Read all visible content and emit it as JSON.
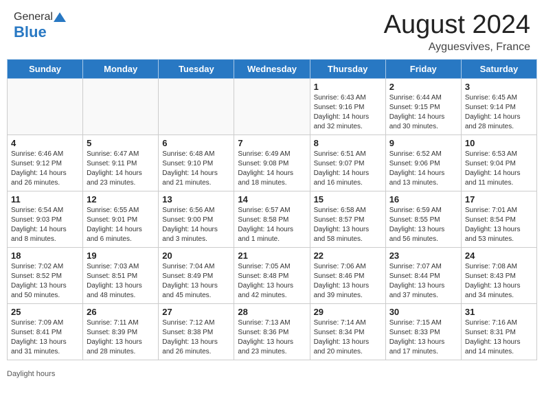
{
  "header": {
    "logo_general": "General",
    "logo_blue": "Blue",
    "month_title": "August 2024",
    "location": "Ayguesvives, France"
  },
  "footer": {
    "daylight_label": "Daylight hours"
  },
  "weekdays": [
    "Sunday",
    "Monday",
    "Tuesday",
    "Wednesday",
    "Thursday",
    "Friday",
    "Saturday"
  ],
  "weeks": [
    [
      {
        "day": "",
        "info": ""
      },
      {
        "day": "",
        "info": ""
      },
      {
        "day": "",
        "info": ""
      },
      {
        "day": "",
        "info": ""
      },
      {
        "day": "1",
        "info": "Sunrise: 6:43 AM\nSunset: 9:16 PM\nDaylight: 14 hours and 32 minutes."
      },
      {
        "day": "2",
        "info": "Sunrise: 6:44 AM\nSunset: 9:15 PM\nDaylight: 14 hours and 30 minutes."
      },
      {
        "day": "3",
        "info": "Sunrise: 6:45 AM\nSunset: 9:14 PM\nDaylight: 14 hours and 28 minutes."
      }
    ],
    [
      {
        "day": "4",
        "info": "Sunrise: 6:46 AM\nSunset: 9:12 PM\nDaylight: 14 hours and 26 minutes."
      },
      {
        "day": "5",
        "info": "Sunrise: 6:47 AM\nSunset: 9:11 PM\nDaylight: 14 hours and 23 minutes."
      },
      {
        "day": "6",
        "info": "Sunrise: 6:48 AM\nSunset: 9:10 PM\nDaylight: 14 hours and 21 minutes."
      },
      {
        "day": "7",
        "info": "Sunrise: 6:49 AM\nSunset: 9:08 PM\nDaylight: 14 hours and 18 minutes."
      },
      {
        "day": "8",
        "info": "Sunrise: 6:51 AM\nSunset: 9:07 PM\nDaylight: 14 hours and 16 minutes."
      },
      {
        "day": "9",
        "info": "Sunrise: 6:52 AM\nSunset: 9:06 PM\nDaylight: 14 hours and 13 minutes."
      },
      {
        "day": "10",
        "info": "Sunrise: 6:53 AM\nSunset: 9:04 PM\nDaylight: 14 hours and 11 minutes."
      }
    ],
    [
      {
        "day": "11",
        "info": "Sunrise: 6:54 AM\nSunset: 9:03 PM\nDaylight: 14 hours and 8 minutes."
      },
      {
        "day": "12",
        "info": "Sunrise: 6:55 AM\nSunset: 9:01 PM\nDaylight: 14 hours and 6 minutes."
      },
      {
        "day": "13",
        "info": "Sunrise: 6:56 AM\nSunset: 9:00 PM\nDaylight: 14 hours and 3 minutes."
      },
      {
        "day": "14",
        "info": "Sunrise: 6:57 AM\nSunset: 8:58 PM\nDaylight: 14 hours and 1 minute."
      },
      {
        "day": "15",
        "info": "Sunrise: 6:58 AM\nSunset: 8:57 PM\nDaylight: 13 hours and 58 minutes."
      },
      {
        "day": "16",
        "info": "Sunrise: 6:59 AM\nSunset: 8:55 PM\nDaylight: 13 hours and 56 minutes."
      },
      {
        "day": "17",
        "info": "Sunrise: 7:01 AM\nSunset: 8:54 PM\nDaylight: 13 hours and 53 minutes."
      }
    ],
    [
      {
        "day": "18",
        "info": "Sunrise: 7:02 AM\nSunset: 8:52 PM\nDaylight: 13 hours and 50 minutes."
      },
      {
        "day": "19",
        "info": "Sunrise: 7:03 AM\nSunset: 8:51 PM\nDaylight: 13 hours and 48 minutes."
      },
      {
        "day": "20",
        "info": "Sunrise: 7:04 AM\nSunset: 8:49 PM\nDaylight: 13 hours and 45 minutes."
      },
      {
        "day": "21",
        "info": "Sunrise: 7:05 AM\nSunset: 8:48 PM\nDaylight: 13 hours and 42 minutes."
      },
      {
        "day": "22",
        "info": "Sunrise: 7:06 AM\nSunset: 8:46 PM\nDaylight: 13 hours and 39 minutes."
      },
      {
        "day": "23",
        "info": "Sunrise: 7:07 AM\nSunset: 8:44 PM\nDaylight: 13 hours and 37 minutes."
      },
      {
        "day": "24",
        "info": "Sunrise: 7:08 AM\nSunset: 8:43 PM\nDaylight: 13 hours and 34 minutes."
      }
    ],
    [
      {
        "day": "25",
        "info": "Sunrise: 7:09 AM\nSunset: 8:41 PM\nDaylight: 13 hours and 31 minutes."
      },
      {
        "day": "26",
        "info": "Sunrise: 7:11 AM\nSunset: 8:39 PM\nDaylight: 13 hours and 28 minutes."
      },
      {
        "day": "27",
        "info": "Sunrise: 7:12 AM\nSunset: 8:38 PM\nDaylight: 13 hours and 26 minutes."
      },
      {
        "day": "28",
        "info": "Sunrise: 7:13 AM\nSunset: 8:36 PM\nDaylight: 13 hours and 23 minutes."
      },
      {
        "day": "29",
        "info": "Sunrise: 7:14 AM\nSunset: 8:34 PM\nDaylight: 13 hours and 20 minutes."
      },
      {
        "day": "30",
        "info": "Sunrise: 7:15 AM\nSunset: 8:33 PM\nDaylight: 13 hours and 17 minutes."
      },
      {
        "day": "31",
        "info": "Sunrise: 7:16 AM\nSunset: 8:31 PM\nDaylight: 13 hours and 14 minutes."
      }
    ]
  ]
}
